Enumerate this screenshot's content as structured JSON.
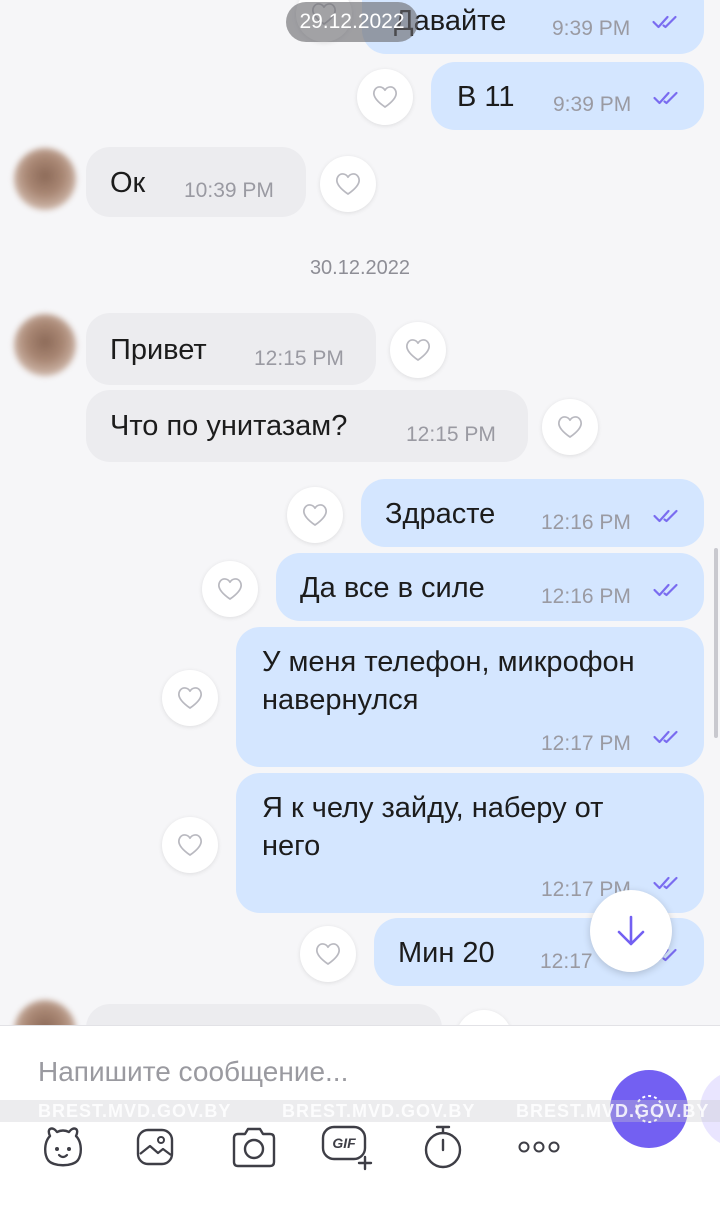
{
  "colors": {
    "accent": "#7360f2",
    "outgoing_bubble": "#d4e6ff",
    "incoming_bubble": "#ececef",
    "read_check": "#7a6cf0"
  },
  "chat": {
    "floating_date": "29.12.2022",
    "date_separator": "30.12.2022",
    "messages": [
      {
        "direction": "out",
        "text": "Давайте",
        "time": "9:39 PM",
        "status": "read"
      },
      {
        "direction": "out",
        "text": "В 11",
        "time": "9:39 PM",
        "status": "read"
      },
      {
        "direction": "in",
        "text": "Ок",
        "time": "10:39 PM"
      },
      {
        "direction": "in",
        "text": "Привет",
        "time": "12:15 PM"
      },
      {
        "direction": "in",
        "text": "Что по унитазам?",
        "time": "12:15 PM"
      },
      {
        "direction": "out",
        "text": "Здрасте",
        "time": "12:16 PM",
        "status": "read"
      },
      {
        "direction": "out",
        "text": "Да все в силе",
        "time": "12:16 PM",
        "status": "read"
      },
      {
        "direction": "out",
        "text": "У меня телефон, микрофон навернулся",
        "lines": [
          "У меня телефон, микрофон",
          "навернулся"
        ],
        "time": "12:17 PM",
        "status": "read"
      },
      {
        "direction": "out",
        "text": "Я к челу зайду, наберу от него",
        "lines": [
          "Я к челу зайду, наберу от",
          "него"
        ],
        "time": "12:17 PM",
        "status": "read"
      },
      {
        "direction": "out",
        "text": "Мин 20",
        "time": "12:17",
        "status": "read"
      }
    ]
  },
  "icons": {
    "reaction": "heart-icon",
    "read_status": "double-check-icon",
    "scroll_down": "arrow-down-icon",
    "send": "send-icon"
  },
  "composer": {
    "placeholder": "Напишите сообщение...",
    "tools": [
      "sticker-icon",
      "gallery-icon",
      "camera-icon",
      "gif-icon",
      "timer-icon",
      "more-icon"
    ],
    "gif_label": "GIF"
  },
  "watermark": {
    "items": [
      "BREST.MVD.GOV.BY",
      "BREST.MVD.GOV.BY",
      "BREST.MVD.GOV.BY"
    ]
  }
}
